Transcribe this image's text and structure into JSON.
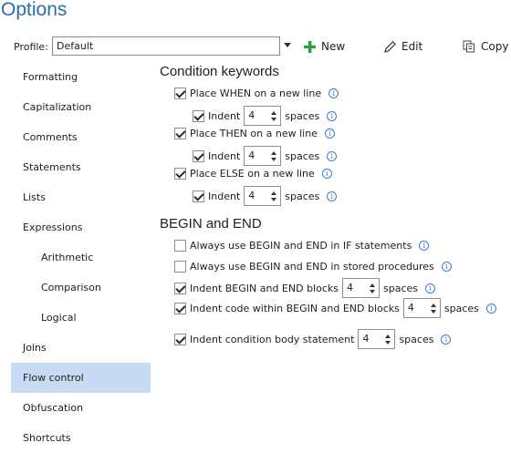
{
  "window": {
    "title": "Options"
  },
  "profile": {
    "label": "Profile:",
    "value": "Default",
    "actions": {
      "new": "New",
      "edit": "Edit",
      "copy": "Copy"
    }
  },
  "nav": {
    "items": [
      {
        "label": "Formatting"
      },
      {
        "label": "Capitalization"
      },
      {
        "label": "Comments"
      },
      {
        "label": "Statements"
      },
      {
        "label": "Lists"
      },
      {
        "label": "Expressions"
      },
      {
        "label": "Arithmetic"
      },
      {
        "label": "Comparison"
      },
      {
        "label": "Logical"
      },
      {
        "label": "Joins"
      },
      {
        "label": "Flow control"
      },
      {
        "label": "Obfuscation"
      },
      {
        "label": "Shortcuts"
      }
    ],
    "selected": "Flow control"
  },
  "condition": {
    "heading": "Condition keywords",
    "when": {
      "label": "Place WHEN on a new line",
      "checked": true,
      "indent_label": "Indent",
      "indent_checked": true,
      "spaces": "4",
      "unit": "spaces"
    },
    "then": {
      "label": "Place THEN on a new line",
      "checked": true,
      "indent_label": "Indent",
      "indent_checked": true,
      "spaces": "4",
      "unit": "spaces"
    },
    "else": {
      "label": "Place ELSE on a new line",
      "checked": true,
      "indent_label": "Indent",
      "indent_checked": true,
      "spaces": "4",
      "unit": "spaces"
    }
  },
  "begin_end": {
    "heading": "BEGIN and END",
    "if_statements": {
      "label": "Always use BEGIN and END in IF statements",
      "checked": false
    },
    "stored_procedures": {
      "label": "Always use BEGIN and END in stored procedures",
      "checked": false
    },
    "indent_blocks": {
      "label": "Indent BEGIN and END blocks",
      "checked": true,
      "spaces": "4",
      "unit": "spaces"
    },
    "indent_code": {
      "label": "Indent code within BEGIN and END blocks",
      "checked": true,
      "spaces": "4",
      "unit": "spaces"
    },
    "indent_condition": {
      "label": "Indent condition body statement",
      "checked": true,
      "spaces": "4",
      "unit": "spaces"
    }
  },
  "colors": {
    "accent": "#2b6cb0",
    "selected_bg": "#c7dbf4",
    "info": "#3b7fd0",
    "add_icon": "#2e9b3e"
  }
}
